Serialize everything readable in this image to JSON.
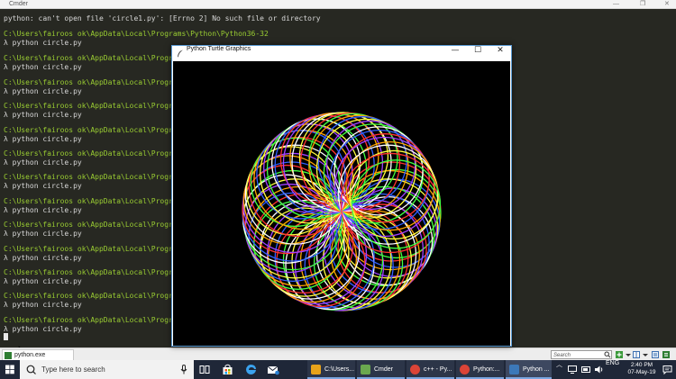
{
  "cmder_window": {
    "title": "Cmder",
    "minimize_glyph": "—",
    "restore_glyph": "❐",
    "close_glyph": "✕"
  },
  "terminal": {
    "error_line": "python: can't open file 'circle1.py': [Errno 2] No such file or directory",
    "first_path": "C:\\Users\\fairoos ok\\AppData\\Local\\Programs\\Python\\Python36-32",
    "path": "C:\\Users\\fairoos ok\\AppData\\Local\\Programs",
    "command": "λ python circle.py",
    "repeat_count_note": ""
  },
  "turtle_window": {
    "title": "Python Turtle Graphics",
    "minimize_glyph": "—",
    "maximize_glyph": "☐",
    "close_glyph": "✕"
  },
  "cmder_bottom": {
    "console_tab": "python.exe",
    "search_placeholder": "Search"
  },
  "taskbar": {
    "search_placeholder": "Type here to search",
    "apps": [
      {
        "label": "C:\\Users...",
        "color": "#e8a31a"
      },
      {
        "label": "Cmder",
        "color": "#6aa84f"
      },
      {
        "label": "c++ - Py...",
        "color": "#db4437"
      },
      {
        "label": "Python:...",
        "color": "#db4437"
      },
      {
        "label": "Python ...",
        "color": "#3c78b8"
      }
    ],
    "language": "ENG",
    "time": "2:40 PM",
    "date": "07-May-19"
  },
  "colors": {
    "terminal_bg": "#272822",
    "path_green": "#9acd32",
    "taskbar_bg": "#1f2738",
    "accent_blue": "#5a9bd5"
  },
  "spirograph": {
    "circle_count": 36,
    "palette": [
      "#ff3030",
      "#ffa500",
      "#ffff40",
      "#40ff40",
      "#3060ff",
      "#a040ff",
      "#ffffff"
    ]
  }
}
